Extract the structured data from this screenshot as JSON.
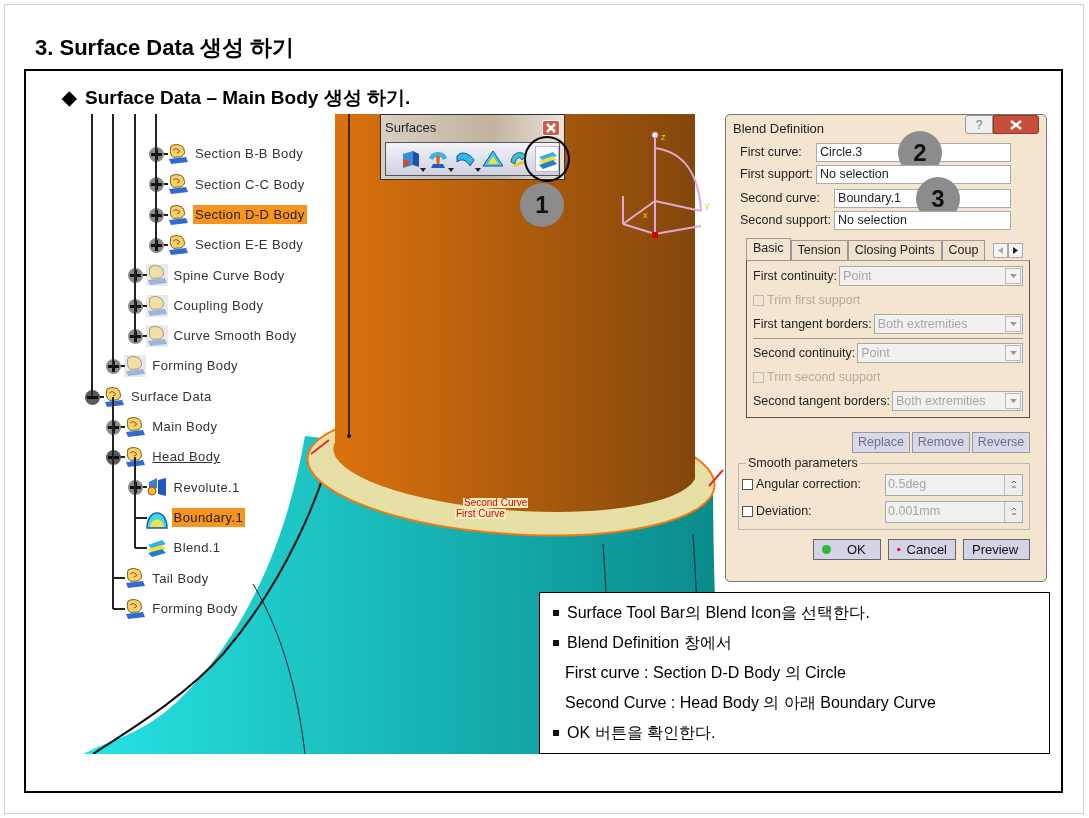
{
  "page_title": "3. Surface Data 생성 하기",
  "section_heading": {
    "marker": "◆",
    "text": "Surface Data – Main Body 생성 하기."
  },
  "tree": {
    "items": [
      {
        "children": [
          {
            "children": [
              {
                "children": [
                  {
                    "label": "Section B-B Body",
                    "kind": "body",
                    "expanded": false,
                    "selected": false,
                    "current": false
                  },
                  {
                    "label": "Section C-C Body",
                    "kind": "body",
                    "expanded": false,
                    "selected": false,
                    "current": false
                  },
                  {
                    "label": "Section D-D Body",
                    "kind": "body",
                    "expanded": false,
                    "selected": true,
                    "current": false
                  },
                  {
                    "label": "Section E-E Body",
                    "kind": "body",
                    "expanded": false,
                    "selected": false,
                    "current": false
                  }
                ]
              },
              {
                "label": "Spine Curve Body",
                "kind": "faded",
                "expanded": false,
                "selected": false,
                "current": false
              },
              {
                "label": "Coupling Body",
                "kind": "faded",
                "expanded": false,
                "selected": false,
                "current": false
              },
              {
                "label": "Curve Smooth Body",
                "kind": "faded",
                "expanded": false,
                "selected": false,
                "current": false
              }
            ]
          },
          {
            "label": "Forming Body",
            "kind": "faded",
            "expanded": false,
            "selected": false,
            "current": false
          }
        ]
      },
      {
        "label": "Surface Data",
        "kind": "body",
        "expanded": true,
        "selected": false,
        "current": false,
        "children": [
          {
            "label": "Main Body",
            "kind": "body",
            "expanded": false,
            "selected": false,
            "current": false
          },
          {
            "label": "Head Body",
            "kind": "body",
            "expanded": true,
            "selected": false,
            "current": true,
            "children": [
              {
                "label": "Revolute.1",
                "kind": "revolute",
                "expanded": false,
                "selected": false,
                "current": false
              },
              {
                "label": "Boundary.1",
                "kind": "boundary",
                "selected": true,
                "current": false
              },
              {
                "label": "Blend.1",
                "kind": "blend",
                "selected": false,
                "current": false
              }
            ]
          },
          {
            "label": "Tail Body",
            "kind": "body",
            "selected": false,
            "current": false
          },
          {
            "label": "Forming Body",
            "kind": "body",
            "selected": false,
            "current": false
          }
        ]
      }
    ]
  },
  "toolbar": {
    "title": "Surfaces",
    "callout": "1",
    "tools": [
      {
        "kind": "extrude",
        "has_menu": true,
        "highlighted": false
      },
      {
        "kind": "revolve",
        "has_menu": true,
        "highlighted": false
      },
      {
        "kind": "sweep",
        "has_menu": true,
        "highlighted": false
      },
      {
        "kind": "fill",
        "has_menu": false,
        "highlighted": false
      },
      {
        "kind": "multi-section",
        "has_menu": false,
        "highlighted": false
      },
      {
        "kind": "blend",
        "has_menu": false,
        "highlighted": true
      }
    ]
  },
  "viewport": {
    "axis_labels": [
      "z",
      "y",
      "x"
    ],
    "curve_labels": [
      "Second Curve",
      "First Curve"
    ]
  },
  "dialog": {
    "title": "Blend Definition",
    "help": "?",
    "fields": [
      {
        "label": "First curve:",
        "value": "Circle.3",
        "callout": "2"
      },
      {
        "label": "First support:",
        "value": "No selection"
      },
      {
        "label": "Second curve:",
        "value": "Boundary.1",
        "callout": "3"
      },
      {
        "label": "Second support:",
        "value": "No selection"
      }
    ],
    "tabs": [
      {
        "label": "Basic",
        "selected": true
      },
      {
        "label": "Tension",
        "selected": false
      },
      {
        "label": "Closing Points",
        "selected": false
      },
      {
        "label": "Coup",
        "selected": false
      }
    ],
    "tab_options": [
      {
        "kind": "dropdown",
        "label": "First continuity:",
        "value": "Point",
        "disabled": true
      },
      {
        "kind": "checkbox",
        "label": "Trim first support",
        "checked": false,
        "disabled": true
      },
      {
        "kind": "dropdown",
        "label": "First tangent borders:",
        "value": "Both extremities",
        "disabled": true
      },
      {
        "kind": "separator"
      },
      {
        "kind": "dropdown",
        "label": "Second continuity:",
        "value": "Point",
        "disabled": true
      },
      {
        "kind": "checkbox",
        "label": "Trim second support",
        "checked": false,
        "disabled": true
      },
      {
        "kind": "dropdown",
        "label": "Second tangent borders:",
        "value": "Both extremities",
        "disabled": true
      }
    ],
    "action_buttons": [
      {
        "label": "Replace",
        "disabled": true
      },
      {
        "label": "Remove",
        "disabled": true
      },
      {
        "label": "Reverse",
        "disabled": true
      }
    ],
    "smooth": {
      "title": "Smooth parameters",
      "options": [
        {
          "label": "Angular correction:",
          "checked": false,
          "value": "0.5deg",
          "disabled": true
        },
        {
          "label": "Deviation:",
          "checked": false,
          "value": "0.001mm",
          "disabled": true
        }
      ]
    },
    "buttons": [
      {
        "label": "OK",
        "kind": "ok"
      },
      {
        "label": "Cancel",
        "kind": "cancel"
      },
      {
        "label": "Preview",
        "kind": "plain"
      }
    ]
  },
  "notes": [
    {
      "text": "Surface Tool Bar의 Blend Icon을 선택한다.",
      "bulleted": true
    },
    {
      "text": "Blend Definition 창에서",
      "bulleted": true
    },
    {
      "text": "First curve : Section D-D Body 의 Circle",
      "bulleted": false
    },
    {
      "text": "Second Curve : Head Body 의 아래 Boundary Curve",
      "bulleted": false
    },
    {
      "text": "OK 버튼을 확인한다.",
      "bulleted": true
    }
  ]
}
